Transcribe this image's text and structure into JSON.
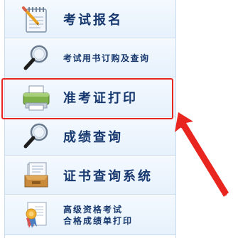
{
  "menu": {
    "items": [
      {
        "label": "考试报名",
        "icon": "notepad-icon"
      },
      {
        "label": "考试用书订购及查询",
        "icon": "magnifier-icon"
      },
      {
        "label": "准考证打印",
        "icon": "printer-icon"
      },
      {
        "label": "成绩查询",
        "icon": "magnifier-icon"
      },
      {
        "label": "证书查询系统",
        "icon": "certificate-box-icon"
      },
      {
        "label_line1": "高级资格考试",
        "label_line2": "合格成绩单打印",
        "icon": "award-ribbon-icon"
      }
    ],
    "highlighted_index": 2
  },
  "colors": {
    "label_text": "#17386e",
    "highlight": "#e8251f",
    "item_bg": "#e6f1fc",
    "border": "#c9dcef"
  }
}
